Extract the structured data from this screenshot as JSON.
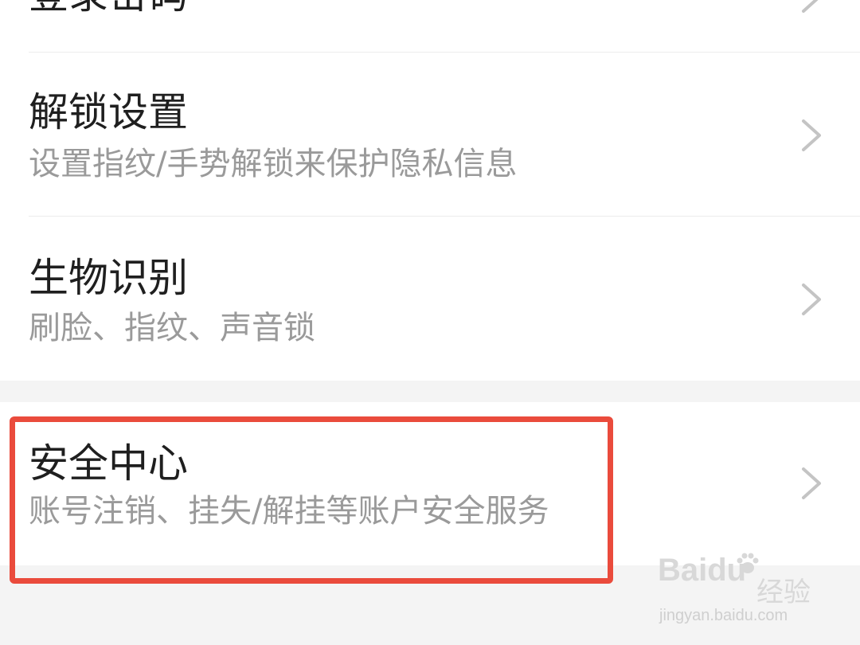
{
  "settings": {
    "items": [
      {
        "title": "登录密码",
        "subtitle": ""
      },
      {
        "title": "解锁设置",
        "subtitle": "设置指纹/手势解锁来保护隐私信息"
      },
      {
        "title": "生物识别",
        "subtitle": "刷脸、指纹、声音锁"
      },
      {
        "title": "安全中心",
        "subtitle": "账号注销、挂失/解挂等账户安全服务"
      }
    ]
  },
  "annotation": {
    "highlight_color": "#ea4b3c"
  },
  "watermark": {
    "logo": "Baidu",
    "product": "经验",
    "url": "jingyan.baidu.com"
  },
  "icons": {
    "chevron": "chevron-right-icon"
  }
}
